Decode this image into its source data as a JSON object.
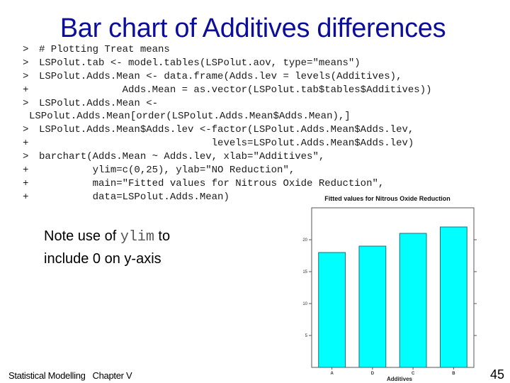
{
  "slide": {
    "title": "Bar chart of Additives differences",
    "footer": "Statistical Modelling   Chapter V",
    "page_number": "45"
  },
  "code_lines": [
    {
      "prompt": ">",
      "text": "# Plotting Treat means"
    },
    {
      "prompt": ">",
      "text": "LSPolut.tab <- model.tables(LSPolut.aov, type=\"means\")"
    },
    {
      "prompt": ">",
      "text": "LSPolut.Adds.Mean <- data.frame(Adds.lev = levels(Additives),"
    },
    {
      "prompt": "+",
      "text": "              Adds.Mean = as.vector(LSPolut.tab$tables$Additives))"
    },
    {
      "prompt": ">",
      "text": "LSPolut.Adds.Mean <-"
    },
    {
      "prompt": "",
      "text": "LSPolut.Adds.Mean[order(LSPolut.Adds.Mean$Adds.Mean),]"
    },
    {
      "prompt": ">",
      "text": "LSPolut.Adds.Mean$Adds.lev <-factor(LSPolut.Adds.Mean$Adds.lev,"
    },
    {
      "prompt": "+",
      "text": "                             levels=LSPolut.Adds.Mean$Adds.lev)"
    },
    {
      "prompt": ">",
      "text": "barchart(Adds.Mean ~ Adds.lev, xlab=\"Additives\","
    },
    {
      "prompt": "+",
      "text": "         ylim=c(0,25), ylab=\"NO Reduction\","
    },
    {
      "prompt": "+",
      "text": "         main=\"Fitted values for Nitrous Oxide Reduction\","
    },
    {
      "prompt": "+",
      "text": "         data=LSPolut.Adds.Mean)"
    }
  ],
  "note": {
    "before": "Note use of ",
    "code": "ylim",
    "after": " to",
    "line2": "include 0 on y-axis"
  },
  "colors": {
    "title": "#0d0d9c",
    "bar_fill": "#00ffff",
    "bar_stroke": "#1f6f7a",
    "axis": "#555555"
  },
  "chart_data": {
    "type": "bar",
    "title": "Fitted values for Nitrous Oxide Reduction",
    "xlabel": "Additives",
    "ylabel": "",
    "categories": [
      "A",
      "D",
      "C",
      "B"
    ],
    "values": [
      18,
      19,
      21,
      22
    ],
    "ylim": [
      0,
      25
    ],
    "yticks": [
      5,
      10,
      15,
      20
    ],
    "ytick_labels": [
      "5",
      "10",
      "15",
      "20"
    ],
    "grid": false,
    "legend": "none"
  }
}
